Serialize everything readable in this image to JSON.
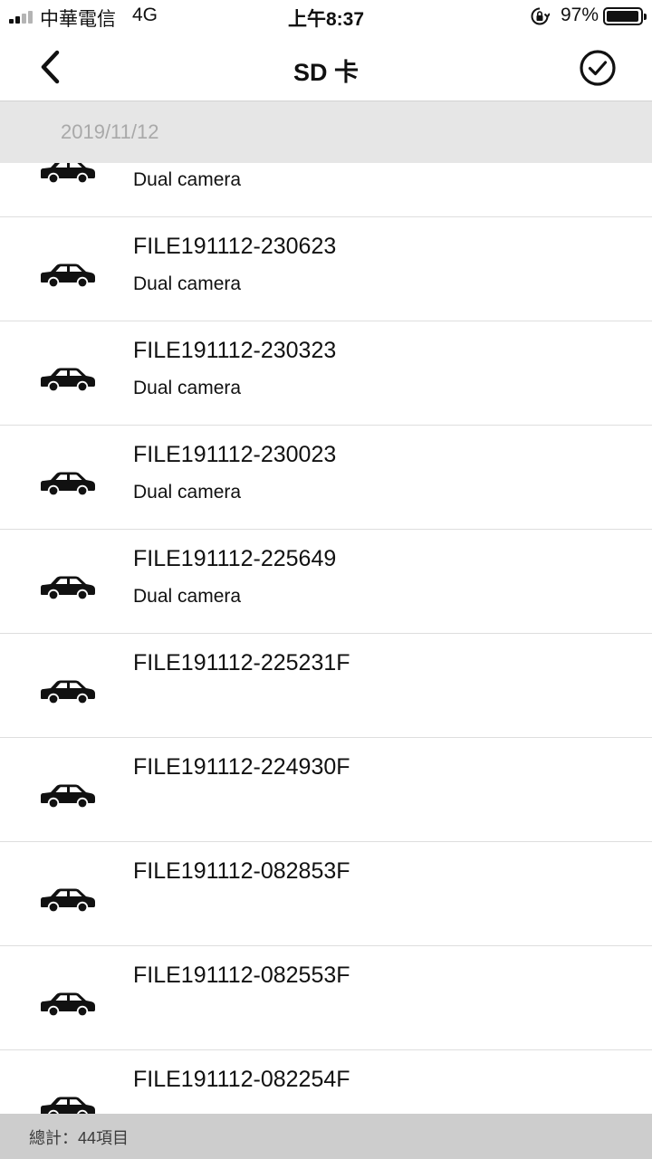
{
  "status_bar": {
    "carrier": "中華電信",
    "network": "4G",
    "time": "上午8:37",
    "battery_percent": "97%",
    "battery_level": 0.97,
    "signal_bars_active": 2,
    "signal_bars_total": 4
  },
  "nav": {
    "title": "SD 卡",
    "back_icon": "chevron-left-icon",
    "confirm_icon": "check-circle-icon"
  },
  "date_header": "2019/11/12",
  "files": [
    {
      "name": "",
      "desc": "Dual camera",
      "icon": "car-icon"
    },
    {
      "name": "FILE191112-230623",
      "desc": "Dual camera",
      "icon": "car-icon"
    },
    {
      "name": "FILE191112-230323",
      "desc": "Dual camera",
      "icon": "car-icon"
    },
    {
      "name": "FILE191112-230023",
      "desc": "Dual camera",
      "icon": "car-icon"
    },
    {
      "name": "FILE191112-225649",
      "desc": "Dual camera",
      "icon": "car-icon"
    },
    {
      "name": "FILE191112-225231F",
      "desc": "",
      "icon": "car-icon"
    },
    {
      "name": "FILE191112-224930F",
      "desc": "",
      "icon": "car-icon"
    },
    {
      "name": "FILE191112-082853F",
      "desc": "",
      "icon": "car-icon"
    },
    {
      "name": "FILE191112-082553F",
      "desc": "",
      "icon": "car-icon"
    },
    {
      "name": "FILE191112-082254F",
      "desc": "",
      "icon": "car-icon"
    }
  ],
  "footer": {
    "total_label": "總計：44項目"
  },
  "colors": {
    "date_header_bg": "#e6e6e6",
    "date_text": "#a9a9a9",
    "footer_bg": "#cdcdcd",
    "divider": "#dedede",
    "signal_active": "#111111",
    "signal_inactive": "#b4b4b4"
  }
}
